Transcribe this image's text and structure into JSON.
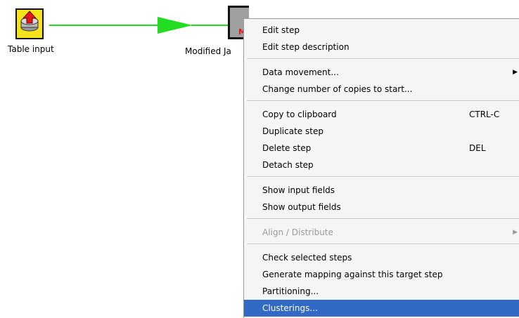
{
  "canvas": {
    "steps": [
      {
        "label": "Table input"
      },
      {
        "label": "Modified Ja"
      }
    ],
    "hop_color": "#22dd22"
  },
  "context_menu": {
    "items": [
      {
        "label": "Edit step"
      },
      {
        "label": "Edit step description"
      },
      {
        "label": "Data movement..."
      },
      {
        "label": "Change number of copies to start..."
      },
      {
        "label": "Copy to clipboard",
        "accelerator": "CTRL-C"
      },
      {
        "label": "Duplicate step"
      },
      {
        "label": "Delete step",
        "accelerator": "DEL"
      },
      {
        "label": "Detach step"
      },
      {
        "label": "Show input fields"
      },
      {
        "label": "Show output fields"
      },
      {
        "label": "Align / Distribute"
      },
      {
        "label": "Check selected steps"
      },
      {
        "label": "Generate mapping against this target step"
      },
      {
        "label": "Partitioning..."
      },
      {
        "label": "Clusterings..."
      }
    ],
    "submenu_arrow": "▶",
    "highlight_color": "#316ac5"
  }
}
